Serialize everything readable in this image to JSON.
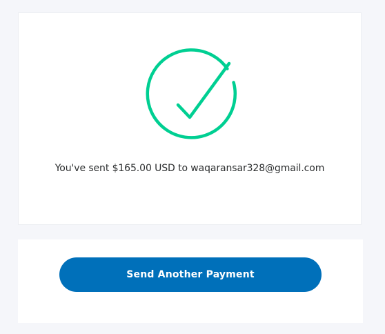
{
  "confirmation": {
    "icon": "check-circle-icon",
    "icon_color": "#00cf92",
    "message": "You've sent $165.00 USD to waqaransar328@gmail.com"
  },
  "actions": {
    "send_another_label": "Send Another Payment",
    "button_color": "#0070ba"
  }
}
